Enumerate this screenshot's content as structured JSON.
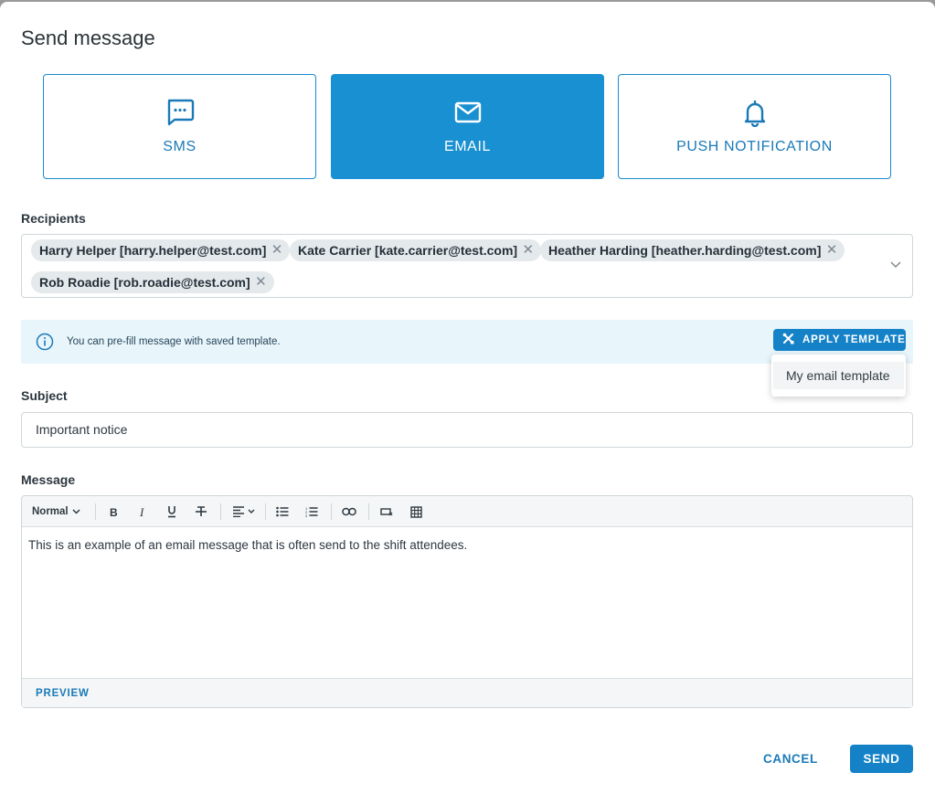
{
  "dialog": {
    "title": "Send message"
  },
  "message_types": [
    {
      "label": "SMS",
      "icon": "chat-icon",
      "active": false
    },
    {
      "label": "EMAIL",
      "icon": "envelope-icon",
      "active": true
    },
    {
      "label": "PUSH NOTIFICATION",
      "icon": "bell-icon",
      "active": false
    }
  ],
  "recipients": {
    "label": "Recipients",
    "chips": [
      {
        "text": "Harry Helper [harry.helper@test.com]"
      },
      {
        "text": "Kate Carrier [kate.carrier@test.com]"
      },
      {
        "text": "Heather Harding [heather.harding@test.com]"
      },
      {
        "text": "Rob Roadie [rob.roadie@test.com]"
      }
    ]
  },
  "template_bar": {
    "info_text": "You can pre-fill message with saved template.",
    "apply_label": "APPLY TEMPLATE",
    "menu_items": [
      "My email template"
    ]
  },
  "subject": {
    "label": "Subject",
    "value": "Important notice"
  },
  "message": {
    "label": "Message",
    "format_select": "Normal",
    "body": "This is an example of an email message that is often send to the shift attendees.",
    "preview_label": "PREVIEW"
  },
  "actions": {
    "cancel_label": "CANCEL",
    "send_label": "SEND"
  },
  "colors": {
    "accent": "#1890d1",
    "info_bg": "#e8f5fb",
    "chip_bg": "#e4e9ec"
  }
}
